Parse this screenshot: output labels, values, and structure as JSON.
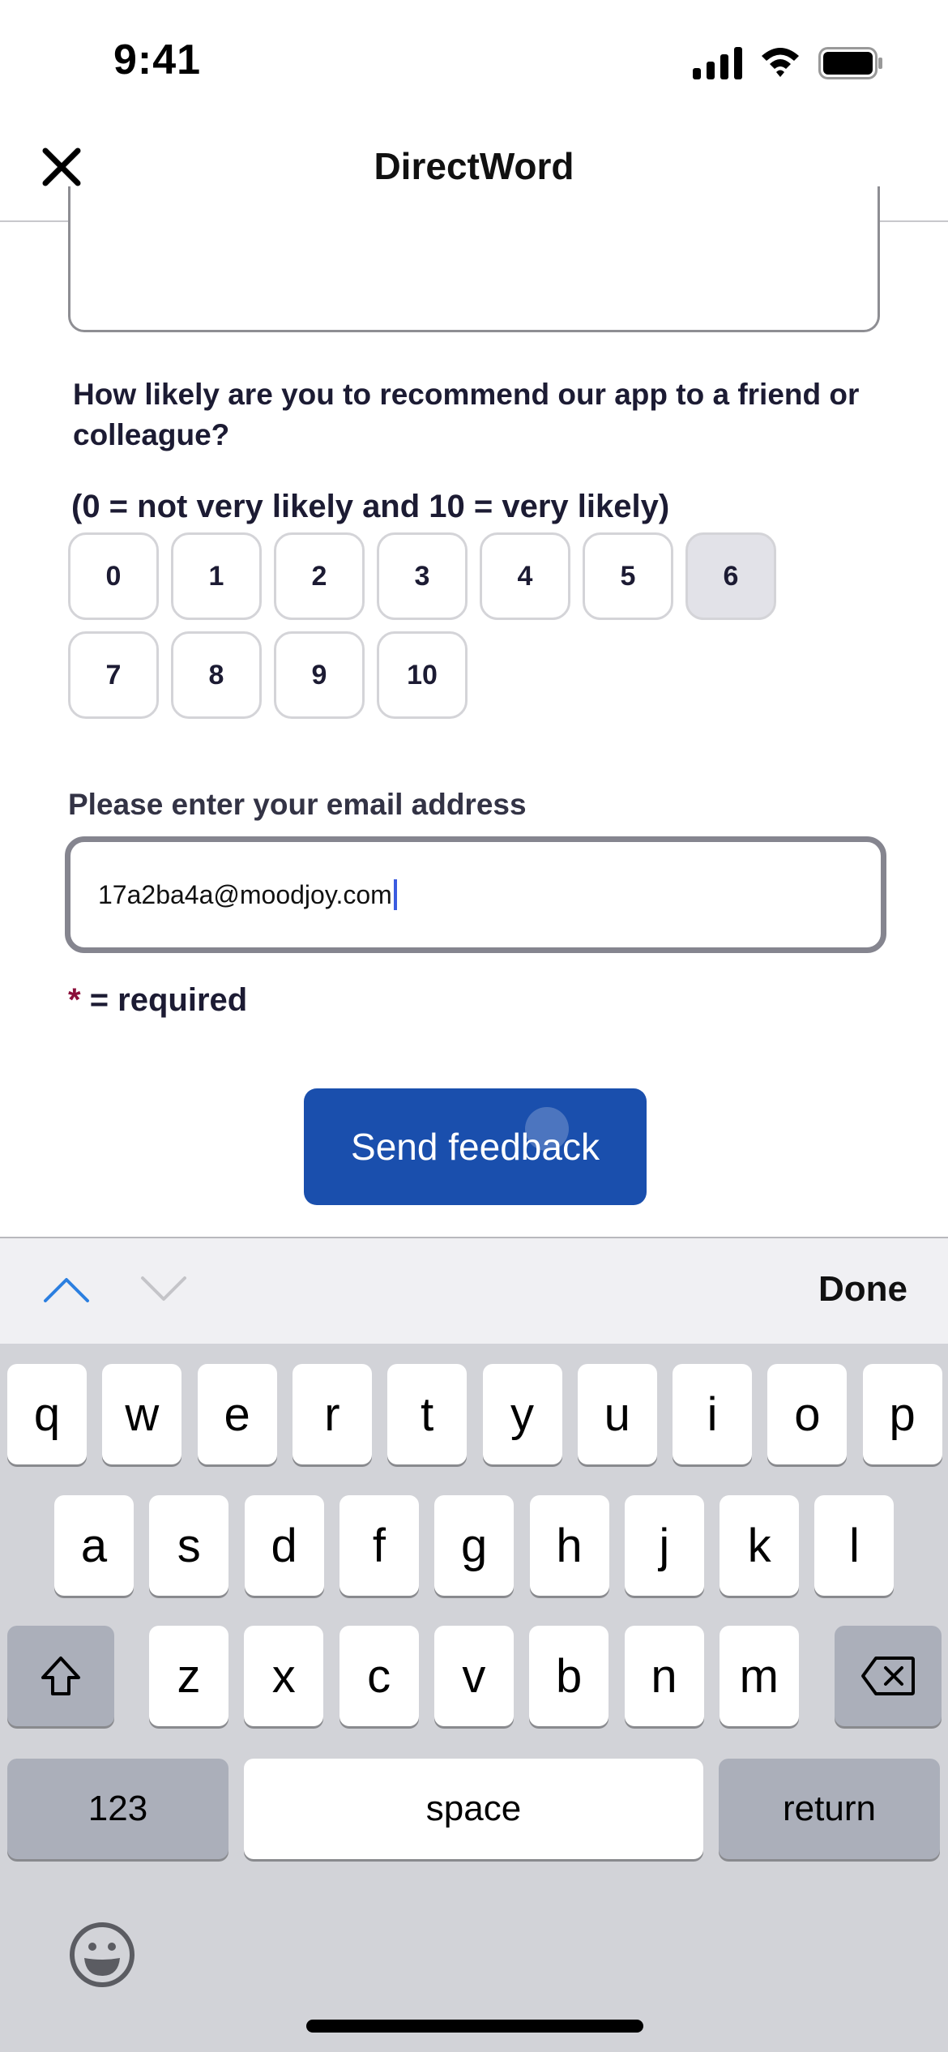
{
  "status_bar": {
    "time": "9:41",
    "icons": [
      "signal-icon",
      "wifi-icon",
      "battery-icon"
    ]
  },
  "header": {
    "title": "DirectWord",
    "close_icon": "close-icon"
  },
  "form": {
    "question": "How likely are you to recommend our app to a friend or colleague?",
    "scale_hint": "(0 = not very likely and 10 = very likely)",
    "rating_options": [
      "0",
      "1",
      "2",
      "3",
      "4",
      "5",
      "6",
      "7",
      "8",
      "9",
      "10"
    ],
    "selected_rating": "6",
    "email_label": "Please enter your email address",
    "email_value": "17a2ba4a@moodjoy.com",
    "required_star": "*",
    "required_text": "= required",
    "submit_label": "Send feedback"
  },
  "keyboard_toolbar": {
    "prev_icon": "chevron-up-icon",
    "next_icon": "chevron-down-icon",
    "done_label": "Done"
  },
  "keyboard": {
    "row1": [
      "q",
      "w",
      "e",
      "r",
      "t",
      "y",
      "u",
      "i",
      "o",
      "p"
    ],
    "row2": [
      "a",
      "s",
      "d",
      "f",
      "g",
      "h",
      "j",
      "k",
      "l"
    ],
    "row3": [
      "z",
      "x",
      "c",
      "v",
      "b",
      "n",
      "m"
    ],
    "shift_icon": "shift-icon",
    "delete_icon": "delete-icon",
    "numbers_label": "123",
    "space_label": "space",
    "return_label": "return",
    "emoji_icon": "emoji-icon"
  },
  "colors": {
    "accent": "#1a4fad",
    "required": "#8b0f3a",
    "caret": "#3a5be0",
    "toolbar_active": "#2b7fe0"
  }
}
